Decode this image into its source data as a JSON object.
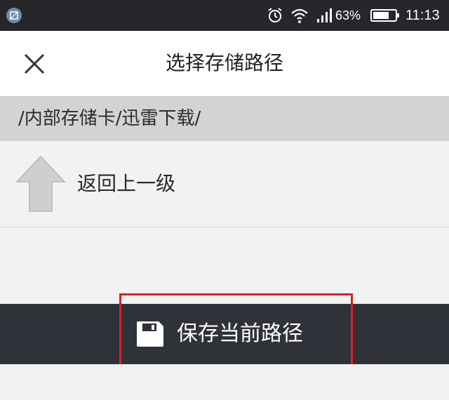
{
  "status_bar": {
    "battery_percent": "63%",
    "time": "11:13",
    "icons": [
      "screenshot-app-icon",
      "alarm-icon",
      "wifi-icon",
      "signal-icon",
      "battery-icon"
    ]
  },
  "header": {
    "title": "选择存储路径",
    "close_icon": "close-icon"
  },
  "path": {
    "current": "/内部存储卡/迅雷下载/"
  },
  "list": {
    "items": [
      {
        "label": "返回上一级",
        "icon": "up-arrow-icon"
      }
    ]
  },
  "footer": {
    "save_label": "保存当前路径",
    "save_icon": "floppy-disk-icon"
  },
  "colors": {
    "status_bar_bg": "#27272b",
    "path_bar_bg": "#d3d3d3",
    "bottom_bar_bg": "#2f3238",
    "highlight": "#e02020"
  }
}
